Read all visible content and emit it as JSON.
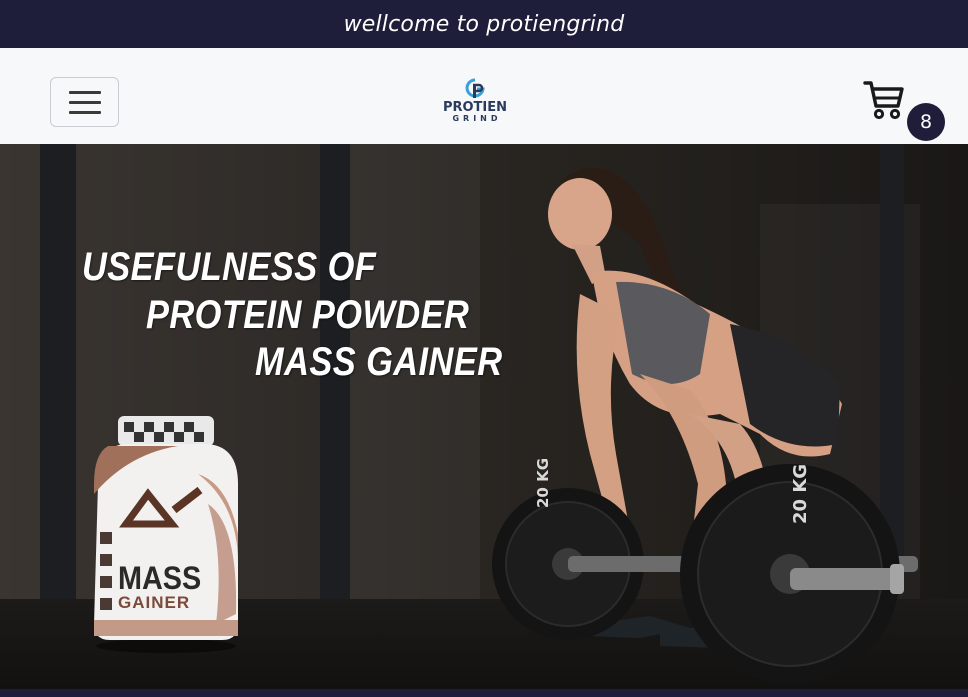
{
  "banner": {
    "text": "wellcome to protiengrind"
  },
  "header": {
    "menu_icon": "hamburger-icon",
    "logo": {
      "name": "PROTIEN",
      "sub": "GRIND"
    },
    "cart": {
      "icon": "cart-icon",
      "count": "8"
    }
  },
  "hero": {
    "headline": {
      "line1": "USEFULNESS OF",
      "line2": "PROTEIN POWDER",
      "line3": "MASS GAINER"
    },
    "product": {
      "name": "MASS",
      "subname": "GAINER"
    },
    "plates": {
      "left": "20 KG",
      "right": "20 KG"
    }
  },
  "colors": {
    "navy": "#1e1e3a",
    "logo_blue": "#3aa0d8"
  }
}
